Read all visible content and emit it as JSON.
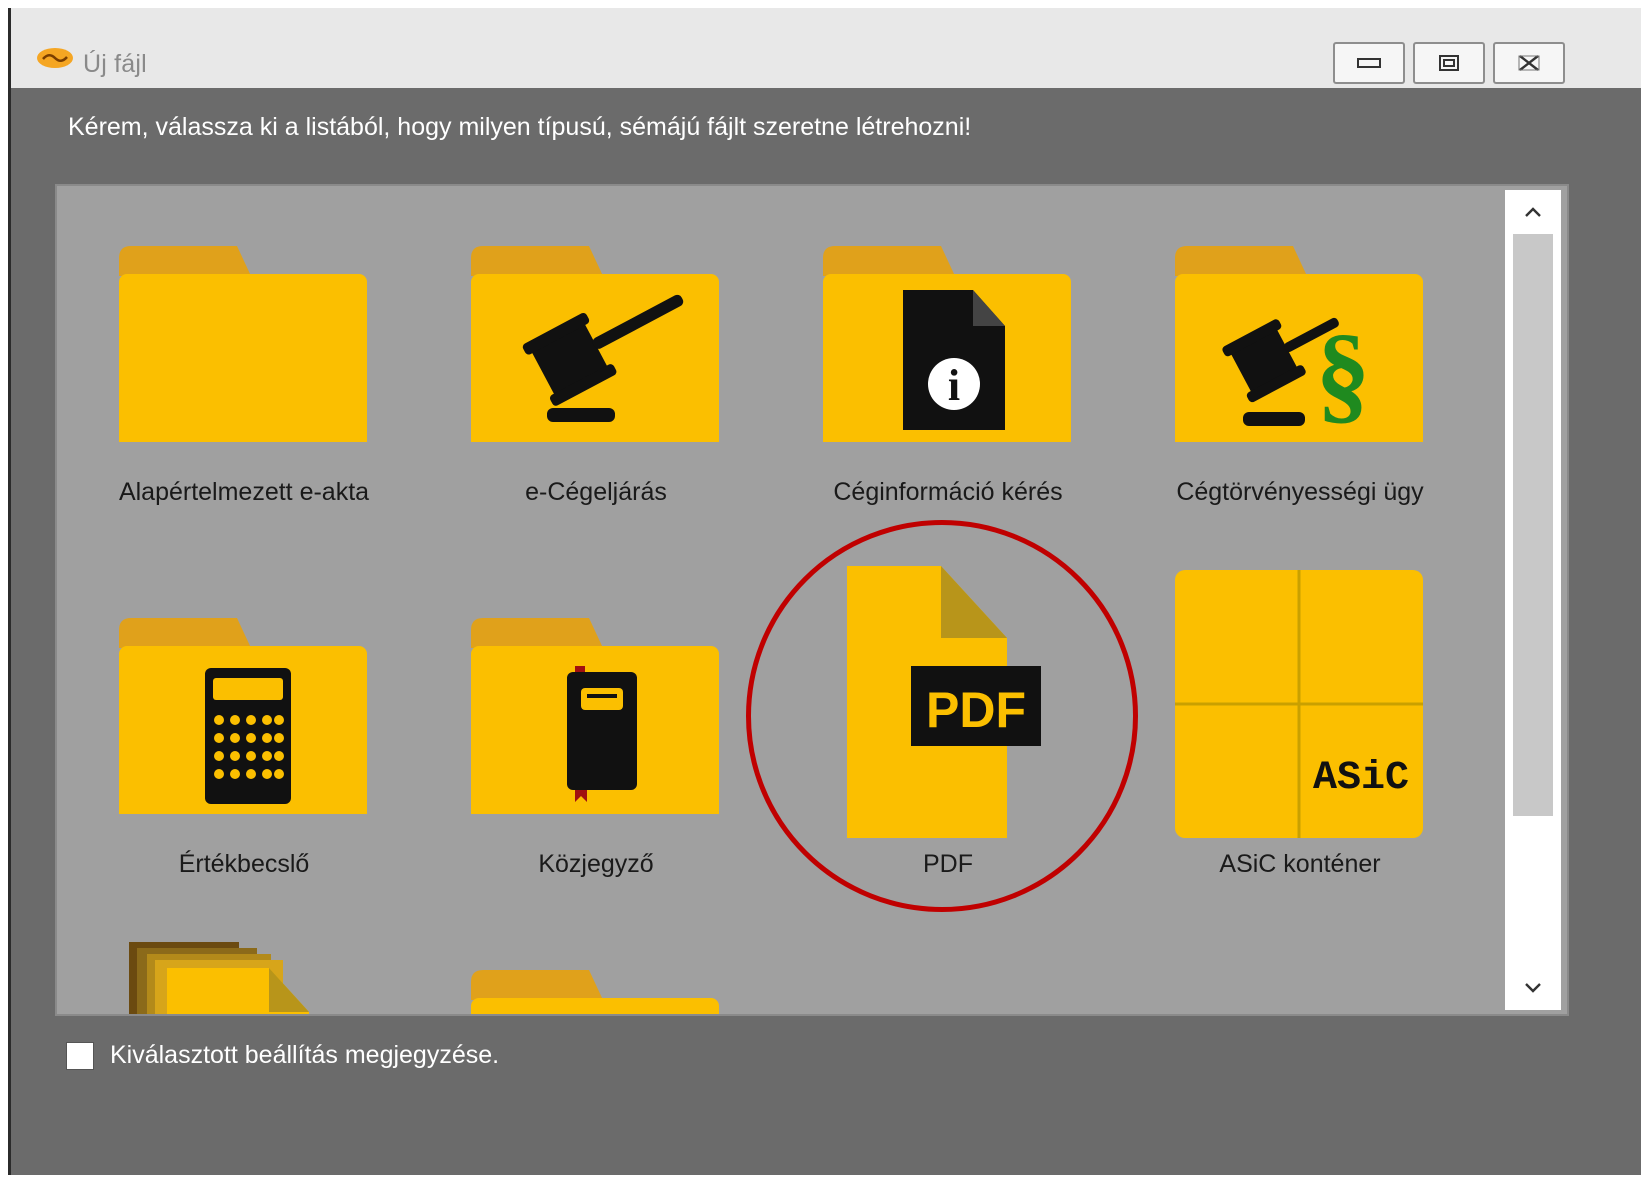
{
  "window": {
    "title": "Új fájl",
    "app_icon": "app-logo-icon",
    "controls": [
      "minimize-icon",
      "maximize-icon",
      "close-icon"
    ]
  },
  "prompt": "Kérem, válassza ki a listából, hogy milyen típusú, sémájú fájlt szeretne létrehozni!",
  "items": [
    {
      "label": "Alapértelmezett e-akta",
      "icon": "folder-icon"
    },
    {
      "label": "e-Cégeljárás",
      "icon": "gavel-folder-icon"
    },
    {
      "label": "Céginformáció kérés",
      "icon": "info-document-folder-icon"
    },
    {
      "label": "Cégtörvényességi ügy",
      "icon": "gavel-paragraph-folder-icon"
    },
    {
      "label": "Értékbecslő",
      "icon": "calculator-folder-icon"
    },
    {
      "label": "Közjegyző",
      "icon": "notebook-folder-icon"
    },
    {
      "label": "PDF",
      "icon": "pdf-document-icon",
      "badge": "PDF"
    },
    {
      "label": "ASiC konténer",
      "icon": "asic-container-icon",
      "badge": "ASiC"
    }
  ],
  "remember": {
    "label": "Kiválasztott beállítás megjegyzése.",
    "checked": false
  },
  "colors": {
    "folder": "#fbbf00",
    "folder_tab": "#e0a11b",
    "panel": "#a0a0a0",
    "window": "#6b6b6b",
    "highlight": "#c00000"
  }
}
